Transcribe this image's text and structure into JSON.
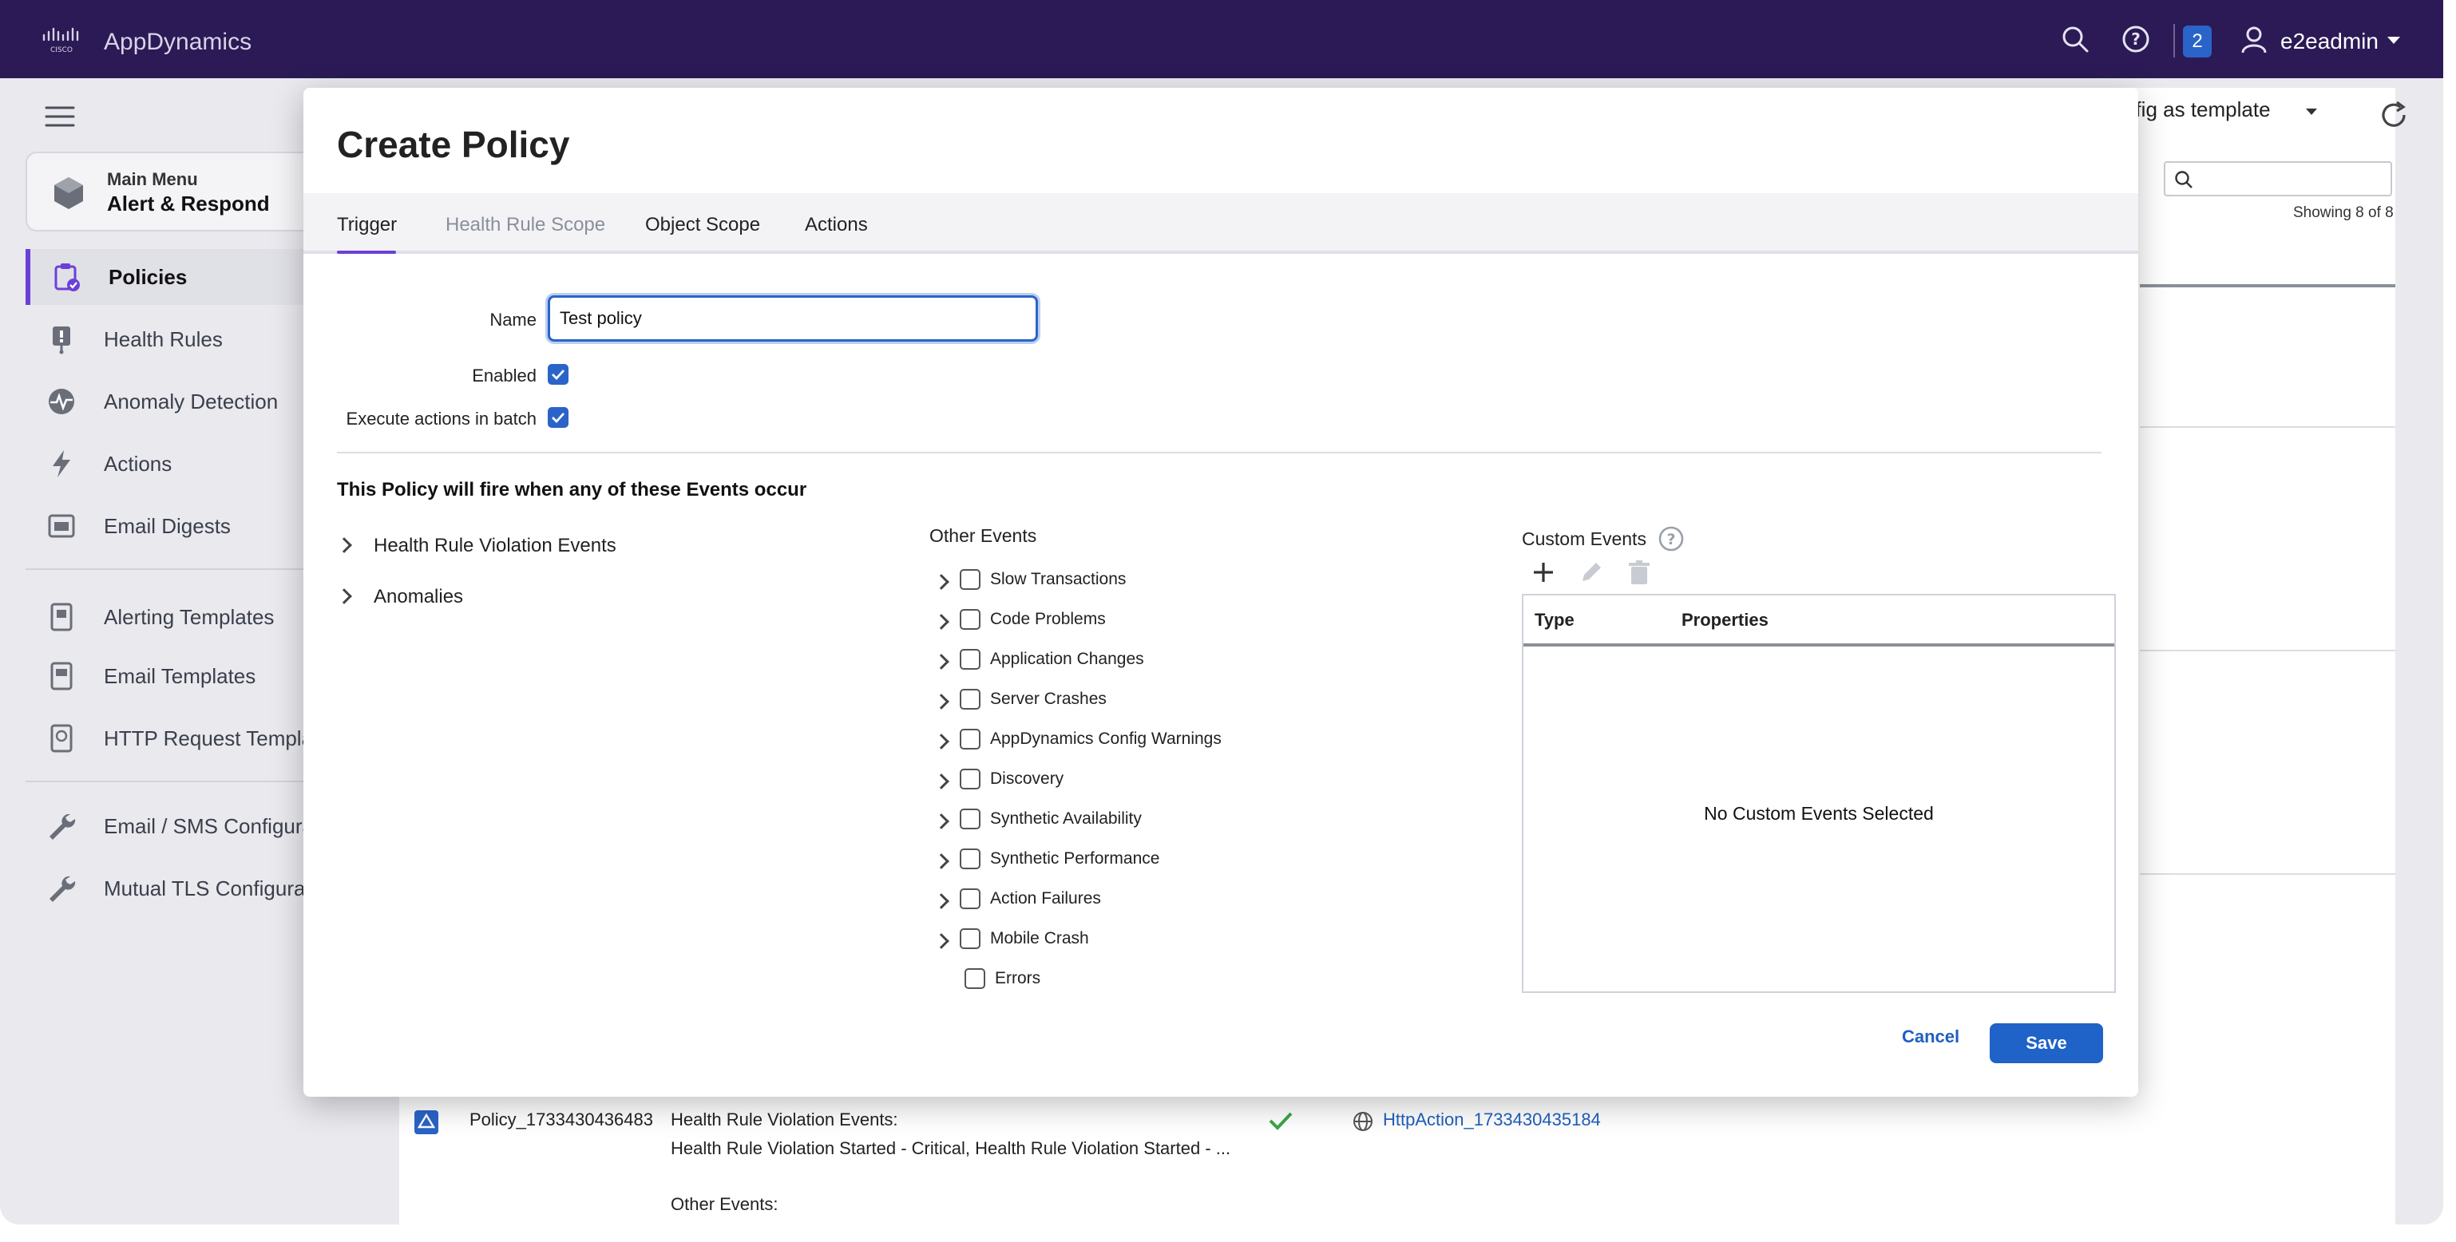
{
  "topbar": {
    "app_name": "AppDynamics",
    "notification_count": "2",
    "user": "e2eadmin"
  },
  "sidebar": {
    "main_menu_small": "Main Menu",
    "main_menu_big": "Alert & Respond",
    "items": [
      {
        "label": "Policies"
      },
      {
        "label": "Health Rules"
      },
      {
        "label": "Anomaly Detection"
      },
      {
        "label": "Actions"
      },
      {
        "label": "Email Digests"
      },
      {
        "label": "Alerting Templates"
      },
      {
        "label": "Email Templates"
      },
      {
        "label": "HTTP Request Templat"
      },
      {
        "label": "Email / SMS Configurat"
      },
      {
        "label": "Mutual TLS Configurati"
      }
    ]
  },
  "background": {
    "config_template": "nfig as template",
    "showing": "Showing 8 of 8",
    "row": {
      "name": "Policy_1733430436483",
      "line1": "Health Rule Violation Events:",
      "line2": "Health Rule Violation Started - Critical, Health Rule Violation Started - ...",
      "line3": "Other Events:",
      "action": "HttpAction_1733430435184"
    }
  },
  "modal": {
    "title": "Create Policy",
    "tabs": [
      "Trigger",
      "Health Rule Scope",
      "Object Scope",
      "Actions"
    ],
    "name_label": "Name",
    "name_value": "Test policy",
    "enabled_label": "Enabled",
    "batch_label": "Execute actions in batch",
    "section_title": "This Policy will fire when any of these Events occur",
    "tree": [
      "Health Rule Violation Events",
      "Anomalies"
    ],
    "other_events_title": "Other Events",
    "other_events": [
      "Slow Transactions",
      "Code Problems",
      "Application Changes",
      "Server Crashes",
      "AppDynamics Config Warnings",
      "Discovery",
      "Synthetic Availability",
      "Synthetic Performance",
      "Action Failures",
      "Mobile Crash",
      "Errors"
    ],
    "custom_events_title": "Custom Events",
    "custom_table": {
      "col_type": "Type",
      "col_properties": "Properties",
      "empty": "No Custom Events Selected"
    },
    "cancel": "Cancel",
    "save": "Save"
  },
  "colors": {
    "topbar": "#2b1a55",
    "accent": "#6c3fd8",
    "primary": "#1f62c8"
  }
}
